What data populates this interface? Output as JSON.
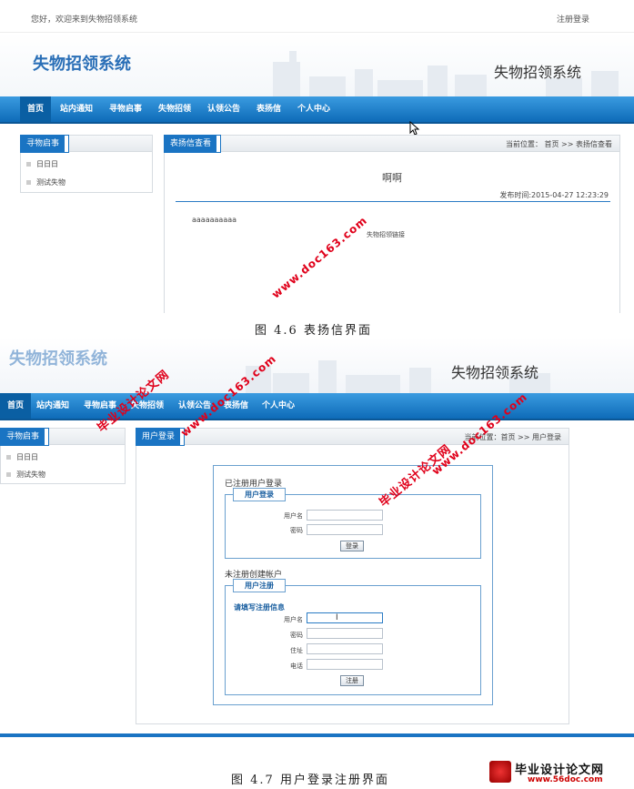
{
  "fig1": {
    "welcome": "您好，欢迎来到失物招领系统",
    "register_login": "注册登录",
    "logo_left": "失物招领系统",
    "logo_right": "失物招领系统",
    "nav": [
      "首页",
      "站内通知",
      "寻物启事",
      "失物招领",
      "认领公告",
      "表扬信",
      "个人中心"
    ],
    "sidebar_title": "寻物启事",
    "sidebar_items": [
      "日日日",
      "测试失物"
    ],
    "main_title": "表扬信查看",
    "breadcrumb": "当前位置： 首页 >>  表扬信查看",
    "article_title": "啊啊",
    "publish_time": "发布时间:2015-04-27 12:23:29",
    "article_body": "aaaaaaaaaa",
    "article_link": "失物招领链接",
    "caption": "图 4.6  表扬信界面"
  },
  "fig2": {
    "logo_left": "失物招领系统",
    "logo_right": "失物招领系统",
    "nav": [
      "首页",
      "站内通知",
      "寻物启事",
      "失物招领",
      "认领公告",
      "表扬信",
      "个人中心"
    ],
    "sidebar_title": "寻物启事",
    "sidebar_items": [
      "日日日",
      "测试失物"
    ],
    "main_title": "用户登录",
    "breadcrumb": "当前位置：首页 >>  用户登录",
    "registered_heading": "已注册用户登录",
    "login_legend": "用户登录",
    "username_label": "用户名",
    "password_label": "密码",
    "login_button": "登录",
    "unregistered_heading": "未注册创建帐户",
    "register_legend": "用户注册",
    "register_hint": "请填写注册信息",
    "reg_username_label": "用户名",
    "reg_password_label": "密码",
    "reg_address_label": "住址",
    "reg_phone_label": "电话",
    "register_button": "注册",
    "caption": "图 4.7  用户登录注册界面"
  },
  "watermarks": {
    "site_cn": "毕业设计论文网",
    "site_url": "www.doc163.com",
    "footer_logo": "毕业设计论文网",
    "footer_url": "www.56doc.com"
  }
}
